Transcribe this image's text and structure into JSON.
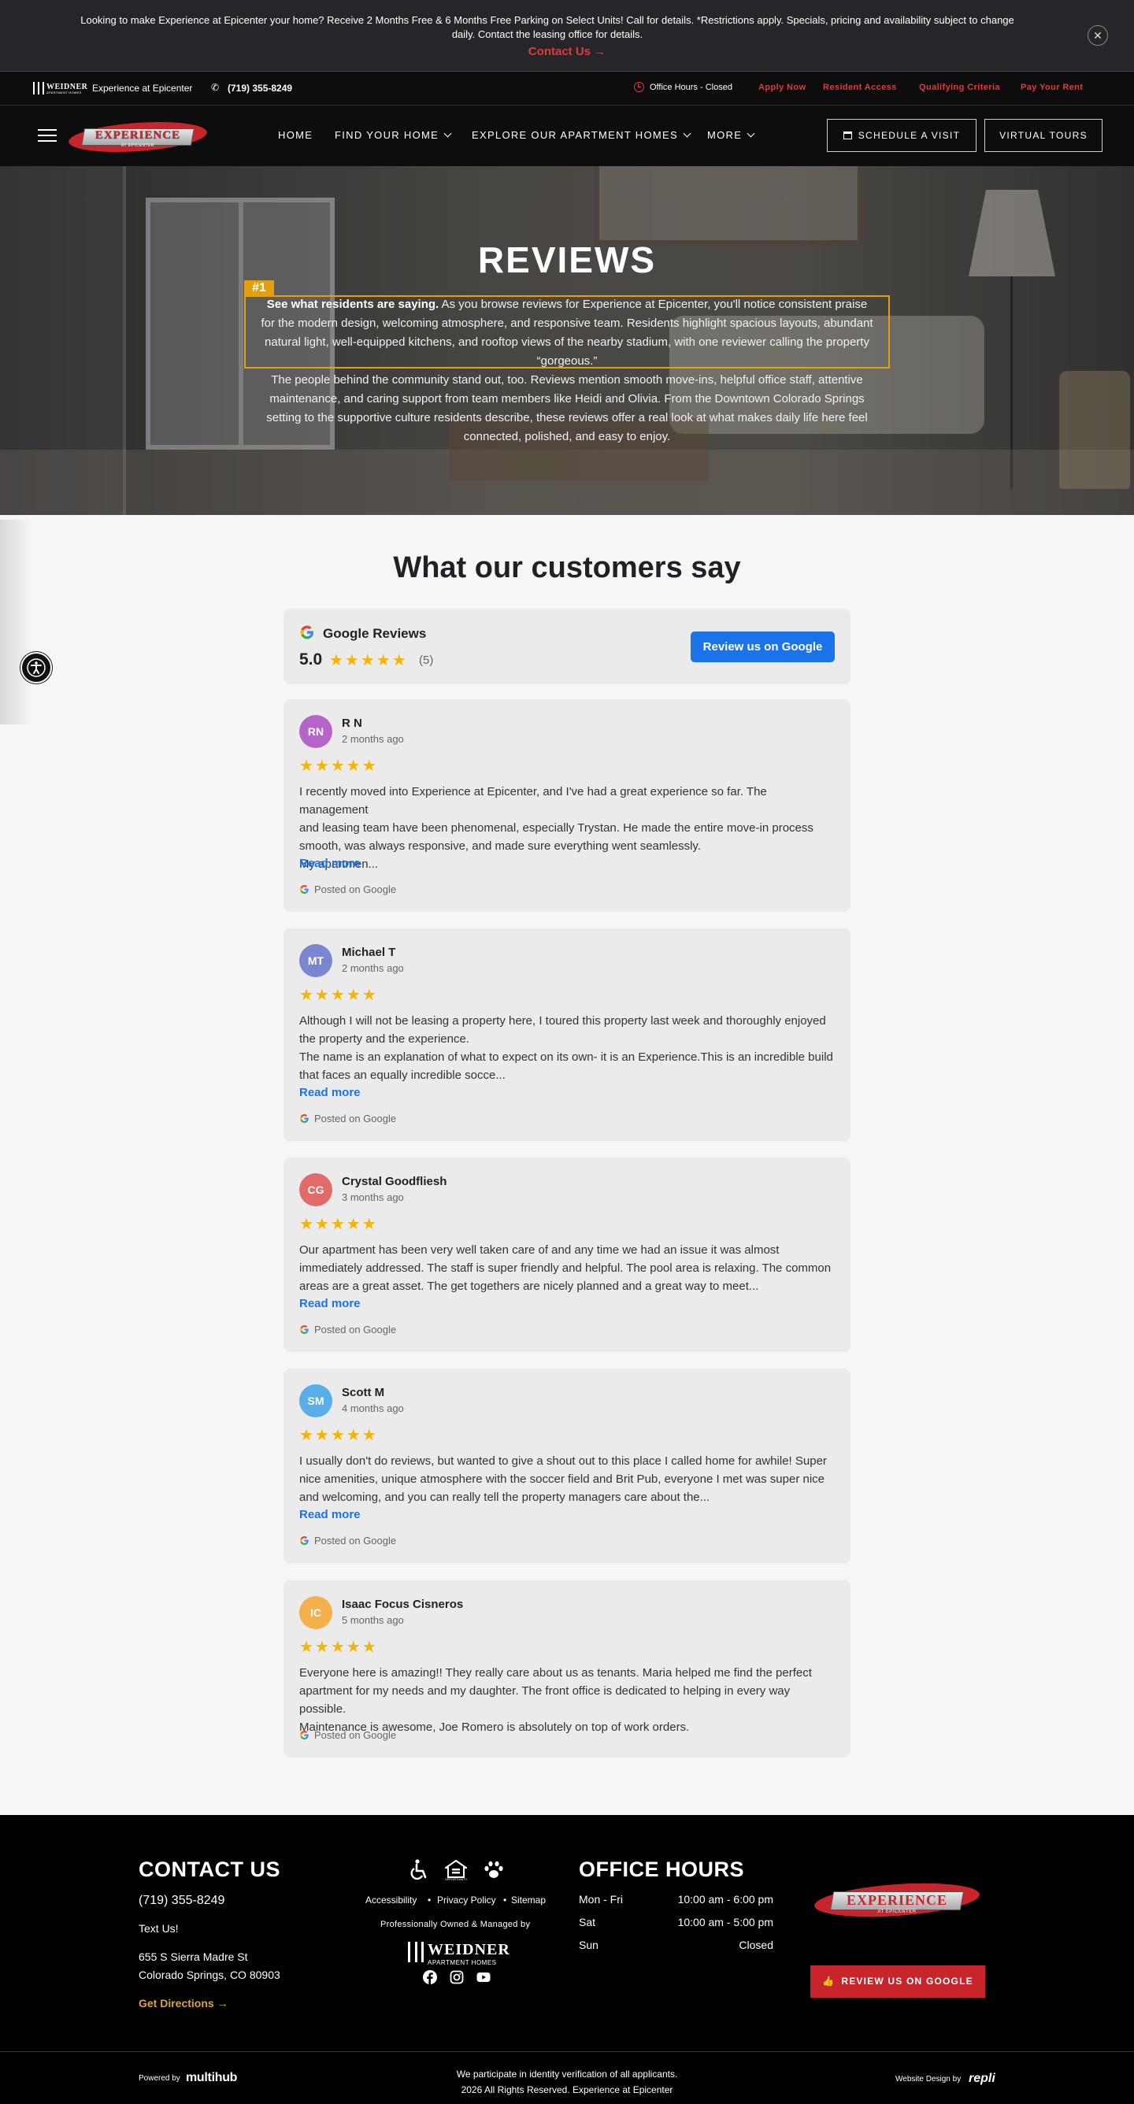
{
  "promo": {
    "text": "Looking to make Experience at Epicenter your home? Receive 2 Months Free & 6 Months Free Parking on Select Units! Call for details. *Restrictions apply. Specials, pricing and availability subject to change daily. Contact the leasing office for details.",
    "link": "Contact Us →",
    "close": "✕"
  },
  "utility": {
    "brand_logo": "WEIDNER",
    "brand_logo_sub": "APARTMENT HOMES",
    "property_name": "Experience at Epicenter",
    "phone": "(719) 355-8249",
    "office_status": "Office Hours - Closed",
    "links": [
      "Apply Now",
      "Resident Access",
      "Qualifying Criteria",
      "Pay Your Rent"
    ]
  },
  "nav": {
    "logo_text": "EXPERIENCE",
    "logo_sub": "AT EPICENTER",
    "items": [
      "Home",
      "Find Your Home",
      "Explore Our Apartment Homes",
      "More"
    ],
    "schedule_button": "Schedule A Visit",
    "tours_button": "Virtual Tours"
  },
  "hero": {
    "title": "REVIEWS",
    "badge": "#1",
    "para1_bold": "See what residents are saying.",
    "para1_line1_rest": " As you browse reviews for Experience at Epicenter, you'll notice consistent praise",
    "para1_line2": "for the modern design, welcoming atmosphere, and responsive team. Residents highlight spacious layouts, abundant",
    "para1_line3": "natural light, well-equipped kitchens, and rooftop views of the nearby stadium, with one reviewer calling the property",
    "para1_line4": "“gorgeous.”",
    "para2_line1": "The people behind the community stand out, too. Reviews mention smooth move-ins, helpful office staff, attentive",
    "para2_line2": "maintenance, and caring support from team members like Heidi and Olivia. From the Downtown Colorado Springs",
    "para2_line3": "setting to the supportive culture residents describe, these reviews offer a real look at what makes daily life here feel",
    "para2_line4": "connected, polished, and easy to enjoy."
  },
  "reviews_section": {
    "title": "What our customers say",
    "summary": {
      "source": "Google Reviews",
      "rating": "5.0",
      "stars": "★★★★★",
      "count": "(5)",
      "button": "Review us on Google"
    },
    "read_more": "Read more",
    "posted_on": "Posted on Google",
    "items": [
      {
        "initials": "RN",
        "name": "R N",
        "date": "2 months ago",
        "stars": "★★★★★",
        "color": "#b565c8",
        "text_lines": [
          "I recently moved into Experience at Epicenter, and I've had a great experience so far. The management",
          "and leasing team have been phenomenal, especially Trystan. He made the entire move-in process",
          "smooth, was always responsive, and made sure everything went seamlessly.",
          "My apartmen..."
        ]
      },
      {
        "initials": "MT",
        "name": "Michael T",
        "date": "2 months ago",
        "stars": "★★★★★",
        "color": "#7b86d1",
        "text_lines": [
          "Although I will not be leasing a property here, I toured this property last week and thoroughly enjoyed",
          "the property and the experience.",
          "The name is an explanation of what to expect on its own- it is an Experience.This is an incredible build",
          "that faces an equally incredible socce..."
        ]
      },
      {
        "initials": "CG",
        "name": "Crystal Goodfliesh",
        "date": "3 months ago",
        "stars": "★★★★★",
        "color": "#e06b68",
        "text_lines": [
          "Our apartment has been very well taken care of and any time we had an issue it was almost",
          "immediately addressed.  The staff is super friendly and helpful. The pool area is relaxing. The common",
          "areas are a great asset.  The get togethers are nicely planned and a great way to meet..."
        ]
      },
      {
        "initials": "SM",
        "name": "Scott M",
        "date": "4 months ago",
        "stars": "★★★★★",
        "color": "#5aaee8",
        "text_lines": [
          "I usually don't do reviews, but wanted to give a shout out to this place I called home for awhile! Super",
          "nice amenities, unique atmosphere with the soccer field and Brit Pub, everyone I met was super nice",
          "and welcoming, and you can really tell the property managers care about the..."
        ]
      },
      {
        "initials": "IC",
        "name": "Isaac Focus Cisneros",
        "date": "5 months ago",
        "stars": "★★★★★",
        "color": "#f4b04a",
        "text_lines": [
          "Everyone here is amazing!! They really care about us as tenants. Maria helped me find the perfect",
          "apartment for my needs and my daughter. The front office is dedicated to helping in every way possible.",
          "Maintenance is awesome, Joe Romero is absolutely on top of work orders."
        ]
      }
    ]
  },
  "footer": {
    "contact_title": "CONTACT US",
    "phone": "(719) 355-8249",
    "text_us": "Text Us!",
    "address_line1": "655 S Sierra Madre St",
    "address_line2": "Colorado Springs, CO 80903",
    "directions": "Get Directions →",
    "links": [
      "Accessibility",
      "•",
      "Privacy Policy",
      "•",
      "Sitemap"
    ],
    "managed_by": "Professionally Owned & Managed by",
    "weidner_logo": "WEIDNER",
    "weidner_sub": "APARTMENT HOMES",
    "hours_title": "OFFICE HOURS",
    "hours": [
      {
        "day": "Mon - Fri",
        "time": "10:00 am - 6:00 pm"
      },
      {
        "day": "Sat",
        "time": "10:00 am - 5:00 pm"
      },
      {
        "day": "Sun",
        "time": "Closed"
      }
    ],
    "logo_text": "EXPERIENCE",
    "logo_sub": "AT EPICENTER",
    "review_button": "REVIEW US ON GOOGLE",
    "powered_by": "Powered by",
    "multihub": "multihub",
    "identity_note": "We participate in identity verification of all applicants.",
    "copyright": "2026 All Rights Reserved. Experience at Epicenter",
    "design_by": "Website Design by",
    "repli": "repli"
  },
  "colors": {
    "accent_red": "#e03a3a",
    "brand_red": "#c8242b",
    "google_blue": "#1a73e8",
    "star_gold": "#f4b400",
    "badge_gold": "#e0a010"
  },
  "icons": [
    "close-icon",
    "phone-icon",
    "clock-icon",
    "hamburger-icon",
    "chevron-down-icon",
    "calendar-icon",
    "google-icon",
    "star-icon",
    "accessibility-icon",
    "wheelchair-icon",
    "equal-housing-icon",
    "paw-icon",
    "facebook-icon",
    "instagram-icon",
    "youtube-icon",
    "thumbs-up-icon"
  ]
}
